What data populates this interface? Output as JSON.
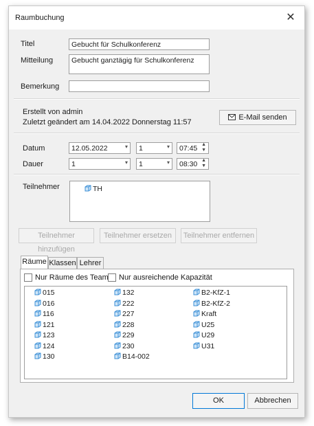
{
  "window": {
    "title": "Raumbuchung"
  },
  "form": {
    "titel_label": "Titel",
    "titel_value": "Gebucht für Schulkonferenz",
    "mitteilung_label": "Mitteilung",
    "mitteilung_value": "Gebucht ganztägig für Schulkonferenz",
    "bemerkung_label": "Bemerkung",
    "bemerkung_value": ""
  },
  "info": {
    "created_by": "Erstellt von admin",
    "last_changed": "Zuletzt geändert  am 14.04.2022 Donnerstag 11:57",
    "email_button": "E-Mail senden"
  },
  "schedule": {
    "datum_label": "Datum",
    "datum_value": "12.05.2022",
    "datum_count": "1",
    "datum_time": "07:45",
    "dauer_label": "Dauer",
    "dauer_value": "1",
    "dauer_count": "1",
    "dauer_time": "08:30"
  },
  "participants": {
    "label": "Teilnehmer",
    "items": [
      "TH"
    ],
    "add_button": "Teilnehmer hinzufügen",
    "replace_button": "Teilnehmer ersetzen",
    "remove_button": "Teilnehmer entfernen"
  },
  "tabs": [
    "Räume",
    "Klassen",
    "Lehrer"
  ],
  "filters": {
    "team_rooms": "Nur Räume des Teams",
    "capacity": "Nur ausreichende Kapazität"
  },
  "rooms": {
    "col1": [
      "015",
      "016",
      "116",
      "121",
      "123",
      "124",
      "130"
    ],
    "col2": [
      "132",
      "222",
      "227",
      "228",
      "229",
      "230",
      "B14-002"
    ],
    "col3": [
      "B2-KfZ-1",
      "B2-KfZ-2",
      "Kraft",
      "U25",
      "U29",
      "U31"
    ]
  },
  "footer": {
    "ok": "OK",
    "cancel": "Abbrechen"
  },
  "colors": {
    "cube_blue": "#3b8fd6",
    "cube_light": "#cfe6f8"
  },
  "icons": {
    "close": "close-icon",
    "mail": "envelope-icon",
    "room": "cube-icon"
  }
}
